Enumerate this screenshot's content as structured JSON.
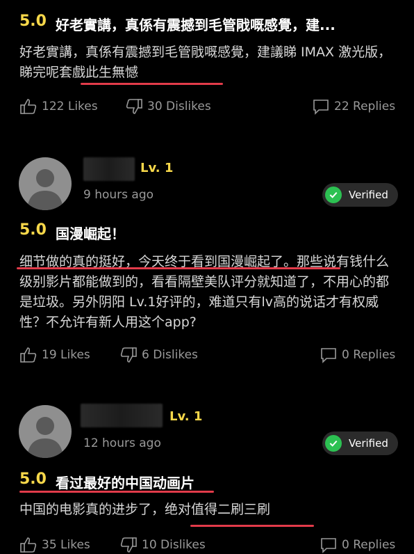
{
  "review1": {
    "rating": "5.0",
    "title": "好老實講，真係有震撼到毛管戙嘅感覺，建...",
    "body": "好老實講，真係有震撼到毛管戙嘅感覺，建議睇 IMAX 激光版，睇完呢套戲此生無憾",
    "likes": "122 Likes",
    "dislikes": "30 Dislikes",
    "replies": "22 Replies"
  },
  "review2": {
    "level": "Lv. 1",
    "time": "9 hours ago",
    "verified": "Verified",
    "rating": "5.0",
    "title": "国漫崛起！",
    "body": "细节做的真的挺好，今天终于看到国漫崛起了。那些说有钱什么级别影片都能做到的，看看隔壁美队评分就知道了，不用心的都是垃圾。另外阴阳 Lv.1好评的，难道只有lv高的说话才有权威性？不允许有新人用这个app?",
    "likes": "19 Likes",
    "dislikes": "6 Dislikes",
    "replies": "0 Replies"
  },
  "review3": {
    "level": "Lv. 1",
    "time": "12 hours ago",
    "verified": "Verified",
    "rating": "5.0",
    "title": "看过最好的中国动画片",
    "body": "中国的电影真的进步了，绝对值得二刷三刷",
    "likes": "35 Likes",
    "dislikes": "10 Dislikes",
    "replies": "0 Replies"
  },
  "colors": {
    "rating": "#f7d84a",
    "underline": "#e23b4a",
    "verified_check": "#2cc152"
  },
  "icons": [
    "thumbs-up-icon",
    "thumbs-down-icon",
    "comment-bubble-icon",
    "checkmark-icon",
    "default-avatar-icon"
  ]
}
